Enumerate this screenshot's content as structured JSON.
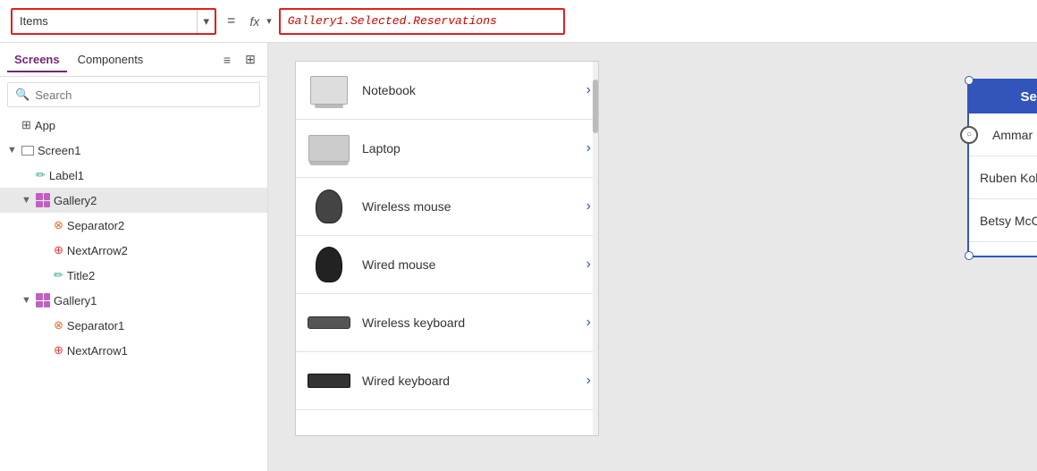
{
  "toolbar": {
    "items_label": "Items",
    "dropdown_arrow": "▾",
    "equals": "=",
    "fx_label": "fx",
    "fx_arrow": "▾",
    "formula": "Gallery1.Selected.Reservations"
  },
  "left_panel": {
    "tabs": [
      {
        "label": "Screens",
        "active": true
      },
      {
        "label": "Components",
        "active": false
      }
    ],
    "search_placeholder": "Search",
    "tree": [
      {
        "label": "App",
        "level": 0,
        "icon": "app",
        "chevron": ""
      },
      {
        "label": "Screen1",
        "level": 0,
        "icon": "screen",
        "chevron": "▼"
      },
      {
        "label": "Label1",
        "level": 1,
        "icon": "label",
        "chevron": ""
      },
      {
        "label": "Gallery2",
        "level": 1,
        "icon": "gallery",
        "chevron": "▼",
        "selected": true
      },
      {
        "label": "Separator2",
        "level": 2,
        "icon": "separator",
        "chevron": ""
      },
      {
        "label": "NextArrow2",
        "level": 2,
        "icon": "next",
        "chevron": ""
      },
      {
        "label": "Title2",
        "level": 2,
        "icon": "title",
        "chevron": ""
      },
      {
        "label": "Gallery1",
        "level": 1,
        "icon": "gallery",
        "chevron": "▼"
      },
      {
        "label": "Separator1",
        "level": 2,
        "icon": "separator",
        "chevron": ""
      },
      {
        "label": "NextArrow1",
        "level": 2,
        "icon": "next",
        "chevron": ""
      }
    ]
  },
  "products": [
    {
      "name": "Notebook",
      "shape": "notebook"
    },
    {
      "name": "Laptop",
      "shape": "laptop"
    },
    {
      "name": "Wireless mouse",
      "shape": "wmouse"
    },
    {
      "name": "Wired mouse",
      "shape": "mouse"
    },
    {
      "name": "Wireless keyboard",
      "shape": "wkeyboard"
    },
    {
      "name": "Wired keyboard",
      "shape": "keyboard"
    }
  ],
  "reservations": {
    "header": "Selected Product Reservations",
    "items": [
      {
        "name": "Ammar Peterson"
      },
      {
        "name": "Ruben Kokshoorn"
      },
      {
        "name": "Betsy McCarthy"
      }
    ]
  }
}
